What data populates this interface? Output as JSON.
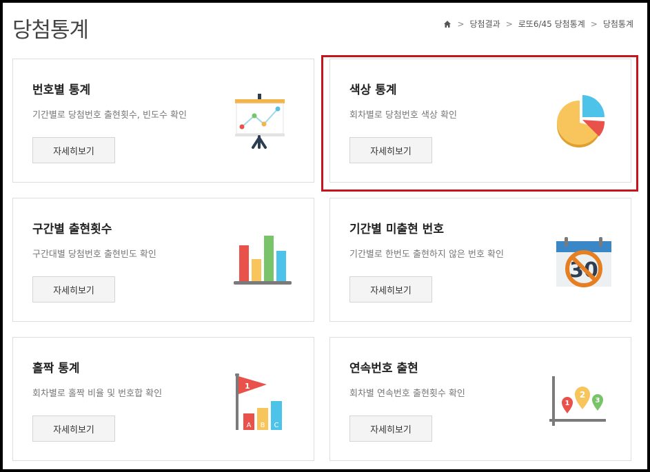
{
  "header": {
    "title": "당첨통계",
    "breadcrumb": [
      "당첨결과",
      "로또6/45 당첨통계",
      "당첨통계"
    ]
  },
  "cards": [
    {
      "title": "번호별 통계",
      "desc": "기간별로 당첨번호 출현횟수, 빈도수 확인",
      "button": "자세히보기",
      "icon": "presentation-chart-icon"
    },
    {
      "title": "색상 통계",
      "desc": "회차별로 당첨번호 색상 확인",
      "button": "자세히보기",
      "icon": "pie-chart-icon",
      "highlighted": true
    },
    {
      "title": "구간별 출현횟수",
      "desc": "구간대별 당첨번호 출현빈도 확인",
      "button": "자세히보기",
      "icon": "bar-chart-icon"
    },
    {
      "title": "기간별 미출현 번호",
      "desc": "기간별로 한번도 출현하지 않은 번호 확인",
      "button": "자세히보기",
      "icon": "calendar-30-no-icon",
      "icon_text": "30"
    },
    {
      "title": "홀짝 통계",
      "desc": "회차별로 홀짝 비율 및 번호합 확인",
      "button": "자세히보기",
      "icon": "flag-abc-bars-icon",
      "icon_text": [
        "1",
        "A",
        "B",
        "C"
      ]
    },
    {
      "title": "연속번호 출현",
      "desc": "회차별 연속번호 출현횟수 확인",
      "button": "자세히보기",
      "icon": "map-pins-123-icon",
      "icon_text": [
        "1",
        "2",
        "3"
      ]
    }
  ],
  "colors": {
    "highlight_border": "#c4151c",
    "card_border": "#dddddd",
    "button_bg": "#f4f4f4"
  }
}
